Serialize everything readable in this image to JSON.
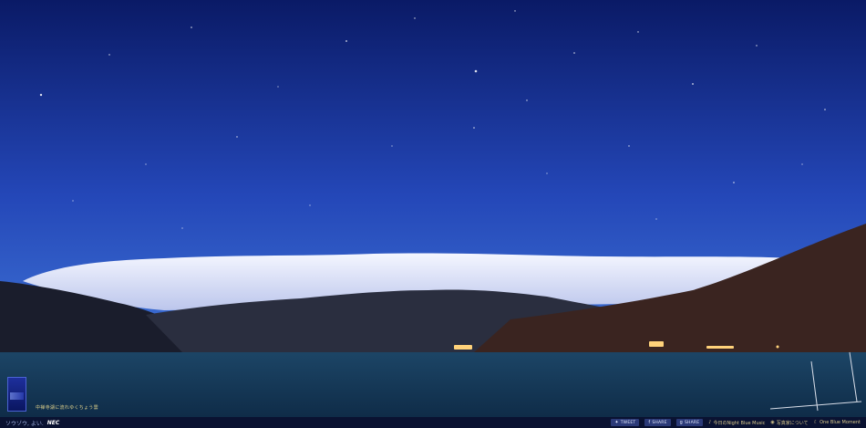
{
  "caption": "中禅寺湖に流れゆくちょう雲",
  "footer": {
    "left_text": "ソウゾウ, よい.",
    "logo": "NEC",
    "share_buttons": [
      {
        "label": "TWEET",
        "icon": "twitter-icon"
      },
      {
        "label": "SHARE",
        "icon": "facebook-icon"
      },
      {
        "label": "SHARE",
        "icon": "google-plus-icon"
      }
    ],
    "links": [
      {
        "label": "今日のNight Blue Music",
        "icon": "music-note-icon"
      },
      {
        "label": "写真家について",
        "icon": "camera-icon"
      },
      {
        "label": "One Blue Moment",
        "icon": "moon-icon"
      }
    ]
  },
  "colors": {
    "sky_top": "#0a1a6a",
    "sky_bottom": "#3a6fd0",
    "lake": "#163a5a",
    "cloud": "#e8ecff",
    "footer": "#0a1231",
    "accent_text": "#e2d38c"
  }
}
